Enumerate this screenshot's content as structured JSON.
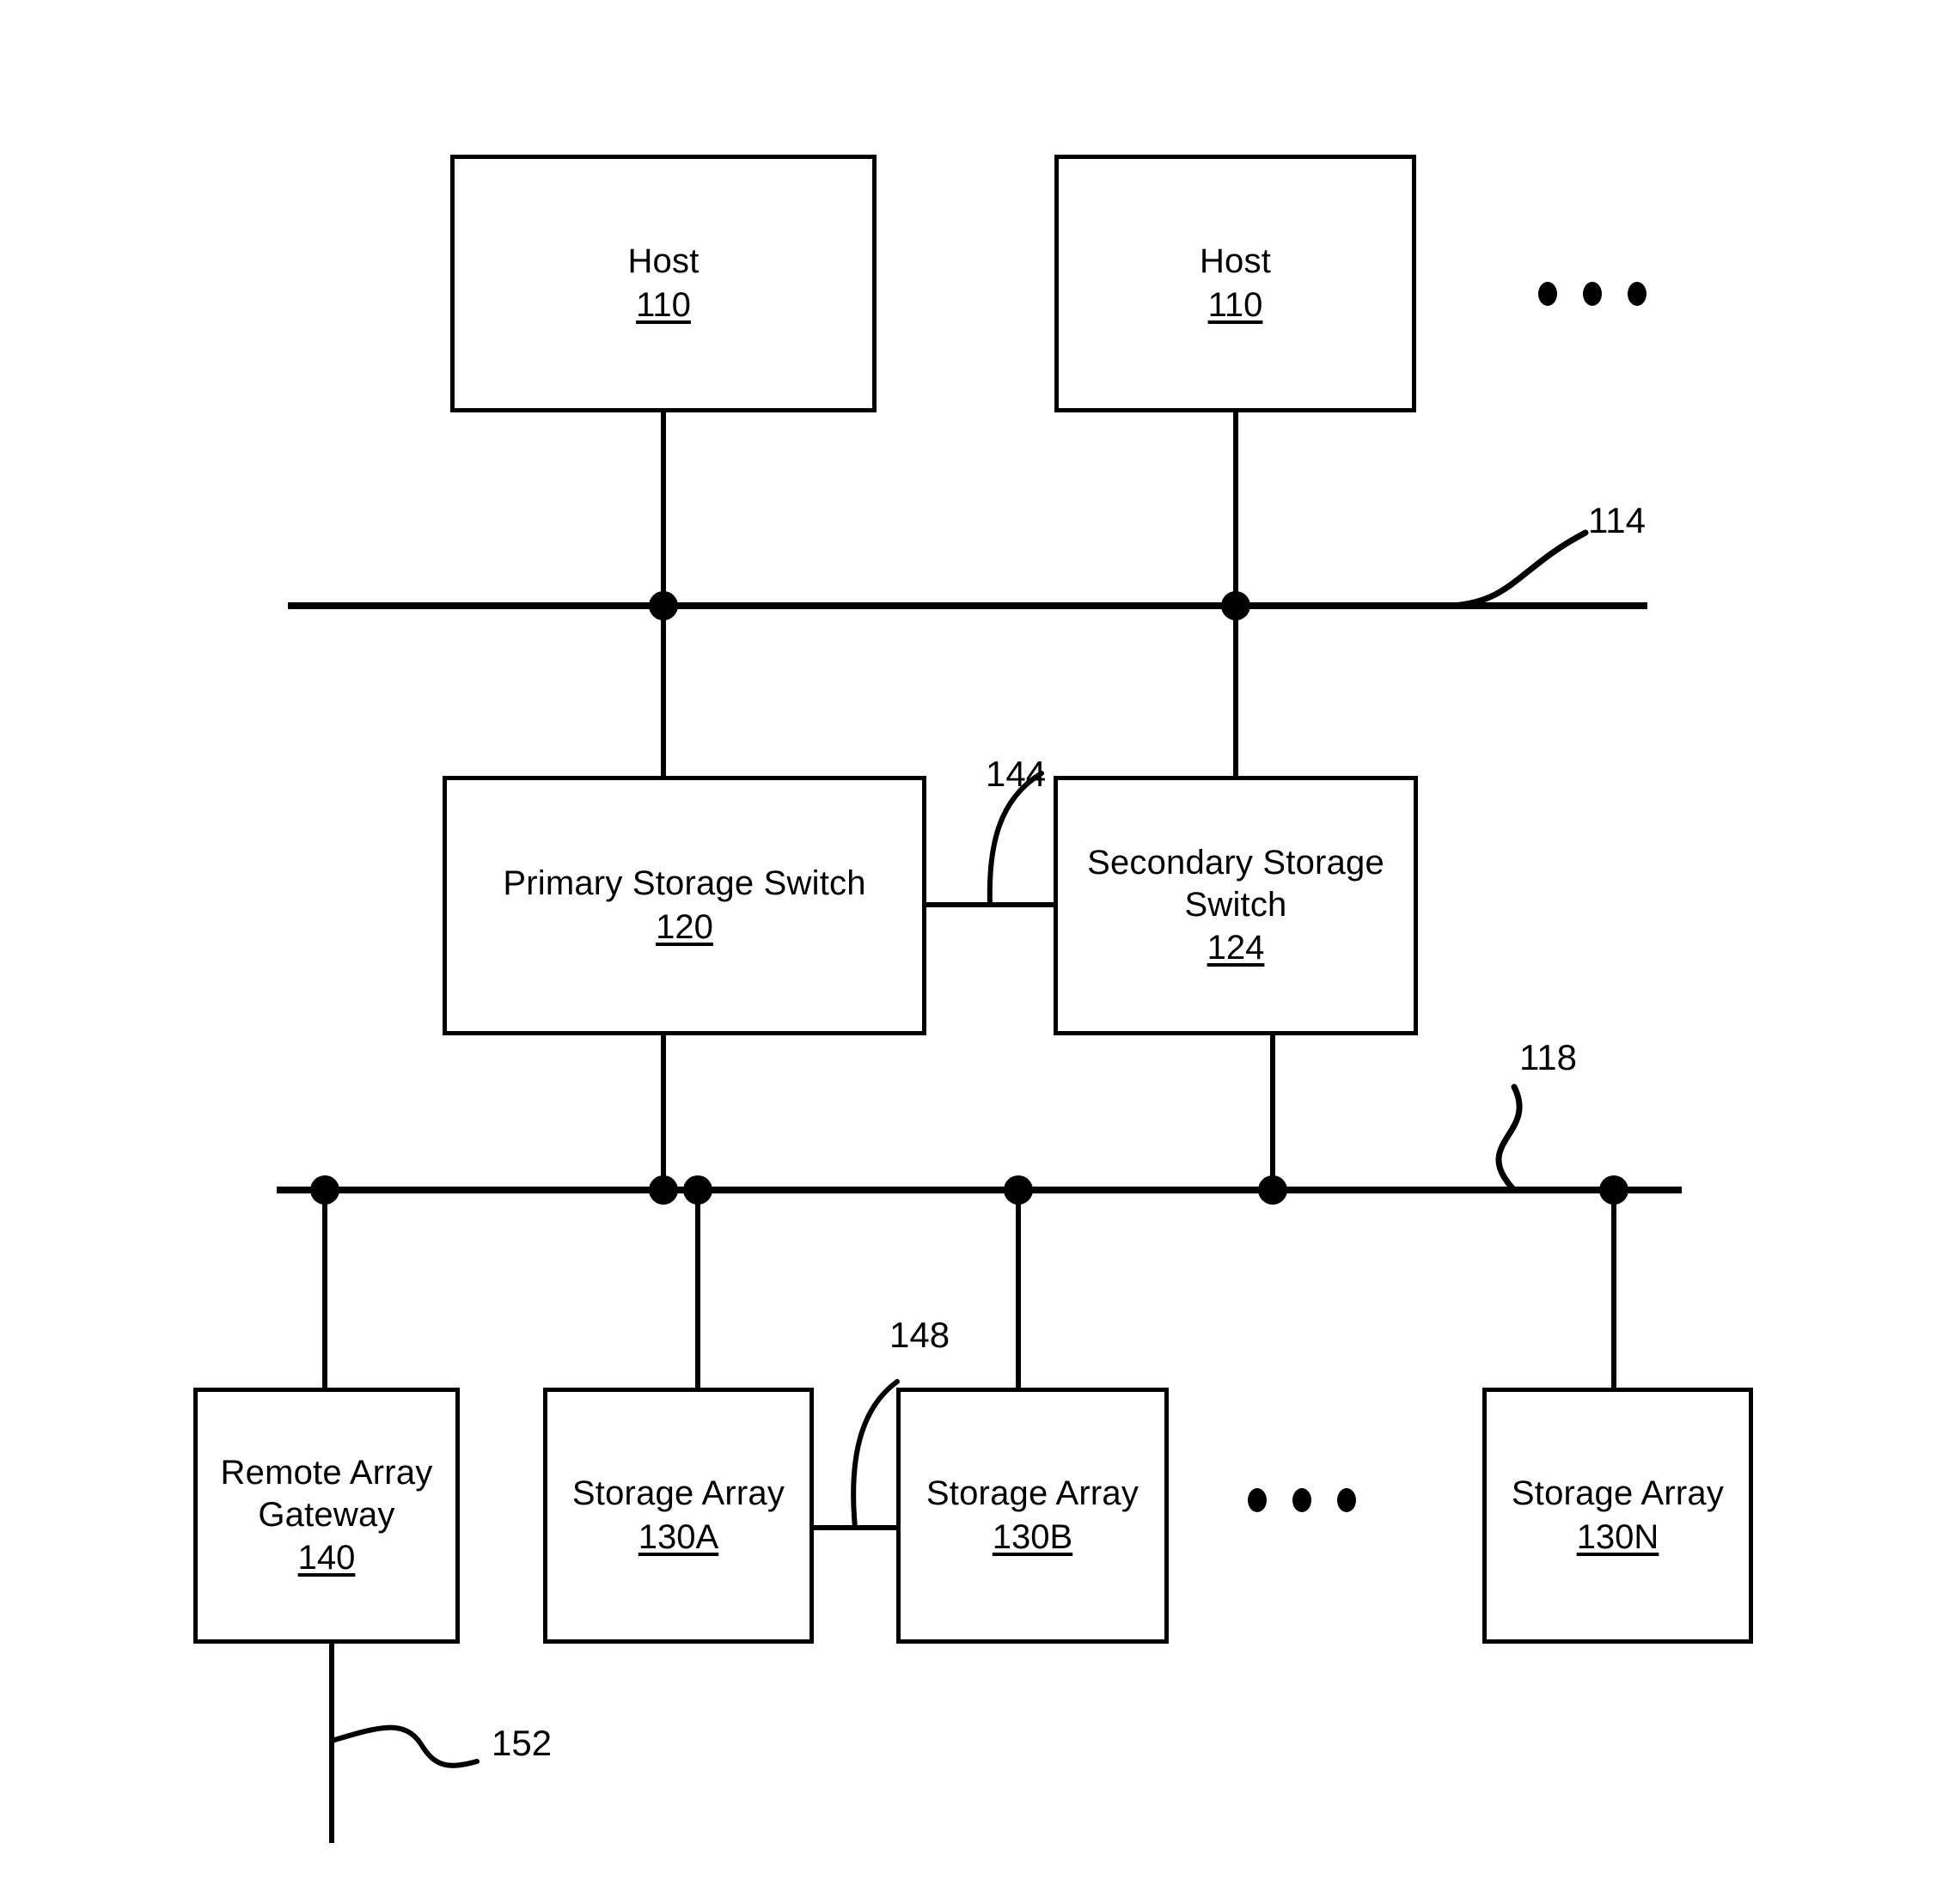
{
  "figure": {
    "kind": "patent-block-diagram",
    "background_color": "#ffffff",
    "line_color": "#000000"
  },
  "nodes": {
    "host_a": {
      "title": "Host",
      "ref": "110"
    },
    "host_b": {
      "title": "Host",
      "ref": "110"
    },
    "primary_switch": {
      "title": "Primary Storage Switch",
      "ref": "120"
    },
    "secondary_switch": {
      "title": "Secondary Storage\nSwitch",
      "ref": "124"
    },
    "remote_gateway": {
      "title": "Remote Array\nGateway",
      "ref": "140"
    },
    "array_a": {
      "title": "Storage Array",
      "ref": "130A"
    },
    "array_b": {
      "title": "Storage Array",
      "ref": "130B"
    },
    "array_n": {
      "title": "Storage Array",
      "ref": "130N"
    }
  },
  "reference_labels": {
    "host_bus": "114",
    "switch_interconnect": "144",
    "storage_bus": "118",
    "array_interconnect": "148",
    "remote_link": "152"
  },
  "ellipses": {
    "hosts_more": "...",
    "arrays_more": "..."
  }
}
